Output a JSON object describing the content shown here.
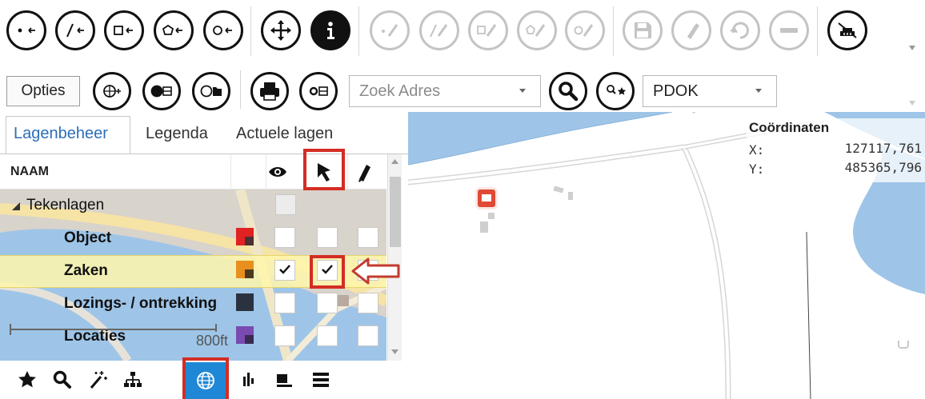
{
  "toolbar_top": {
    "buttons": [
      {
        "icon": "draw-point-icon",
        "enabled": true
      },
      {
        "icon": "draw-line-icon",
        "enabled": true
      },
      {
        "icon": "draw-rectangle-icon",
        "enabled": true
      },
      {
        "icon": "draw-polygon-icon",
        "enabled": true
      },
      {
        "icon": "draw-circle-icon",
        "enabled": true
      },
      {
        "icon": "move-icon",
        "enabled": true
      },
      {
        "icon": "info-icon",
        "enabled": true
      },
      {
        "icon": "edit-point-icon",
        "enabled": false
      },
      {
        "icon": "edit-line-icon",
        "enabled": false
      },
      {
        "icon": "edit-rectangle-icon",
        "enabled": false
      },
      {
        "icon": "edit-polygon-icon",
        "enabled": false
      },
      {
        "icon": "edit-circle-icon",
        "enabled": false
      },
      {
        "icon": "save-icon",
        "enabled": false
      },
      {
        "icon": "pencil-icon",
        "enabled": false
      },
      {
        "icon": "undo-icon",
        "enabled": false
      },
      {
        "icon": "delete-icon",
        "enabled": false
      },
      {
        "icon": "clear-drawing-icon",
        "enabled": true
      }
    ]
  },
  "toolbar_second": {
    "opties_label": "Opties",
    "search_address_placeholder": "Zoek Adres",
    "source_select_value": "PDOK"
  },
  "tabs": {
    "items": [
      "Lagenbeheer",
      "Legenda",
      "Actuele lagen"
    ],
    "active": "Lagenbeheer"
  },
  "layer_grid": {
    "column_name": "NAAM",
    "column_icons": [
      "eye-icon",
      "select-arrow-icon",
      "pencil-icon"
    ],
    "group_label": "Tekenlagen",
    "rows": [
      {
        "label": "Object",
        "visible": false,
        "selectable": false,
        "editable": false,
        "colors": [
          "#e02222",
          "#4a3030"
        ]
      },
      {
        "label": "Zaken",
        "visible": true,
        "selectable": true,
        "editable": false,
        "colors": [
          "#e8901e",
          "#4a3a20"
        ],
        "selected": true
      },
      {
        "label": "Lozings- / ontrekking",
        "visible": false,
        "selectable": false,
        "editable": false,
        "colors": [
          "#2a3240",
          "#2a3240"
        ]
      },
      {
        "label": "Locaties",
        "visible": false,
        "selectable": false,
        "editable": false,
        "colors": [
          "#7a4ab0",
          "#3a2a50"
        ]
      }
    ],
    "scale_label": "800ft"
  },
  "coordinates": {
    "title": "Coördinaten",
    "x_label": "X:",
    "x_value": "127117,761",
    "y_label": "Y:",
    "y_value": "485365,796"
  },
  "bottom_bar": {
    "icons": [
      "star-icon",
      "search-icon",
      "magic-wand-icon",
      "tree-icon",
      "globe-icon",
      "chart-icon",
      "layers-icon",
      "menu-icon"
    ],
    "active": "globe-icon"
  },
  "colors": {
    "water": "#9ec5e8",
    "tab_active": "#2c6fb8",
    "highlight": "#d32d24",
    "selected_row": "#fff6aa",
    "active_bottom": "#1e88d6"
  }
}
